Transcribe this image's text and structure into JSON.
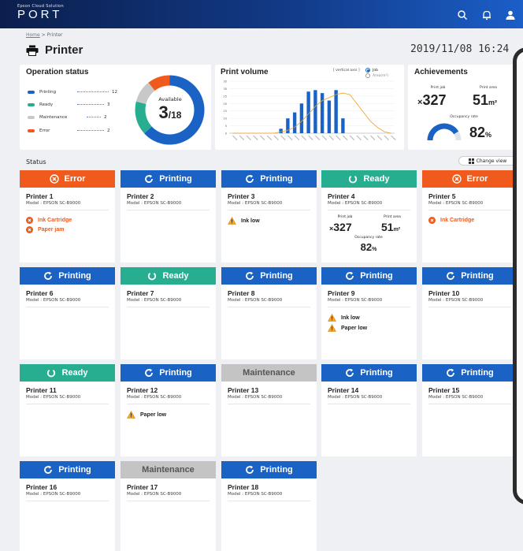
{
  "header": {
    "brand_small": "Epson Cloud Solution",
    "brand_name": "PORT"
  },
  "breadcrumb": {
    "home": "Home",
    "sep": " > ",
    "current": "Printer"
  },
  "page": {
    "title": "Printer",
    "datetime": "2019/11/08 16:24"
  },
  "operation_status": {
    "title": "Operation status",
    "items": [
      {
        "label": "Printing",
        "count": "12",
        "color": "#1a63c4"
      },
      {
        "label": "Ready",
        "count": "3",
        "color": "#27ad8f"
      },
      {
        "label": "Maintenance",
        "count": "2",
        "color": "#c8c8c8"
      },
      {
        "label": "Error",
        "count": "2",
        "color": "#f05a1c"
      }
    ],
    "available_label": "Available",
    "available_value": "3",
    "available_total": "/18"
  },
  "print_volume": {
    "title": "Print volume",
    "vertical_axis_label": "[ vertical axis ]",
    "options": [
      "Job",
      "Area(m²)"
    ],
    "selected": "Job",
    "chart_data": {
      "type": "bar",
      "ylim": [
        0,
        35
      ],
      "yticks": [
        "35",
        "30",
        "25",
        "20",
        "15",
        "10",
        "5",
        "0"
      ],
      "values": [
        0,
        0,
        0,
        0,
        0,
        0,
        0,
        3,
        10,
        14,
        20,
        28,
        29,
        27,
        22,
        29,
        10,
        0,
        0,
        0,
        0,
        0,
        0,
        0
      ],
      "line": [
        0,
        0,
        0,
        0,
        0,
        0,
        0,
        1,
        2,
        4,
        8,
        13,
        18,
        22,
        24,
        26,
        27,
        26,
        20,
        14,
        8,
        4,
        1,
        0
      ]
    }
  },
  "achievements": {
    "title": "Achievements",
    "print_job_label": "Print job",
    "print_job_value": "327",
    "print_job_prefix": "×",
    "print_area_label": "Print area",
    "print_area_value": "51",
    "print_area_unit": "m²",
    "occupancy_label": "Occupancy rate",
    "occupancy_value": "82",
    "occupancy_unit": "%"
  },
  "status_section": {
    "label": "Status",
    "change_view": "Change view"
  },
  "colors": {
    "printing": "#1a63c4",
    "ready": "#27ad8f",
    "maintenance": "#c4c4c4",
    "error": "#f05a1c"
  },
  "printers": [
    {
      "status": "Error",
      "name": "Printer 1",
      "model": "Model : EPSON SC-B9000",
      "alerts": [
        {
          "type": "error",
          "text": "Ink Cartridge"
        },
        {
          "type": "error",
          "text": "Paper jam"
        }
      ]
    },
    {
      "status": "Printing",
      "name": "Printer 2",
      "model": "Model : EPSON SC-B9000",
      "alerts": []
    },
    {
      "status": "Printing",
      "name": "Printer 3",
      "model": "Model : EPSON SC-B9000",
      "alerts": [
        {
          "type": "warning",
          "text": "Ink low"
        }
      ]
    },
    {
      "status": "Ready",
      "name": "Printer 4",
      "model": "Model : EPSON SC-B9000",
      "alerts": [],
      "stats": {
        "job_label": "Print job",
        "job": "327",
        "area_label": "Print area",
        "area": "51",
        "occ_label": "Occupancy rate",
        "occ": "82"
      }
    },
    {
      "status": "Error",
      "name": "Printer 5",
      "model": "Model : EPSON SC-B9000",
      "alerts": [
        {
          "type": "error",
          "text": "Ink Cartridge"
        }
      ]
    },
    {
      "status": "Printing",
      "name": "Printer 6",
      "model": "Model : EPSON SC-B9000",
      "alerts": []
    },
    {
      "status": "Ready",
      "name": "Printer 7",
      "model": "Model : EPSON SC-B9000",
      "alerts": []
    },
    {
      "status": "Printing",
      "name": "Printer 8",
      "model": "Model : EPSON SC-B9000",
      "alerts": []
    },
    {
      "status": "Printing",
      "name": "Printer 9",
      "model": "Model : EPSON SC-B9000",
      "alerts": [
        {
          "type": "warning",
          "text": "Ink low"
        },
        {
          "type": "warning",
          "text": "Paper low"
        }
      ]
    },
    {
      "status": "Printing",
      "name": "Printer 10",
      "model": "Model : EPSON SC-B9000",
      "alerts": []
    },
    {
      "status": "Ready",
      "name": "Printer 11",
      "model": "Model : EPSON SC-B9000",
      "alerts": []
    },
    {
      "status": "Printing",
      "name": "Printer 12",
      "model": "Model : EPSON SC-B9000",
      "alerts": [
        {
          "type": "warning",
          "text": "Paper low"
        }
      ]
    },
    {
      "status": "Maintenance",
      "name": "Printer 13",
      "model": "Model : EPSON SC-B9000",
      "alerts": []
    },
    {
      "status": "Printing",
      "name": "Printer 14",
      "model": "Model : EPSON SC-B9000",
      "alerts": []
    },
    {
      "status": "Printing",
      "name": "Printer 15",
      "model": "Model : EPSON SC-B9000",
      "alerts": []
    },
    {
      "status": "Printing",
      "name": "Printer 16",
      "model": "Model : EPSON SC-B9000",
      "alerts": []
    },
    {
      "status": "Maintenance",
      "name": "Printer 17",
      "model": "Model : EPSON SC-B9000",
      "alerts": []
    },
    {
      "status": "Printing",
      "name": "Printer 18",
      "model": "Model : EPSON SC-B9000",
      "alerts": []
    }
  ]
}
